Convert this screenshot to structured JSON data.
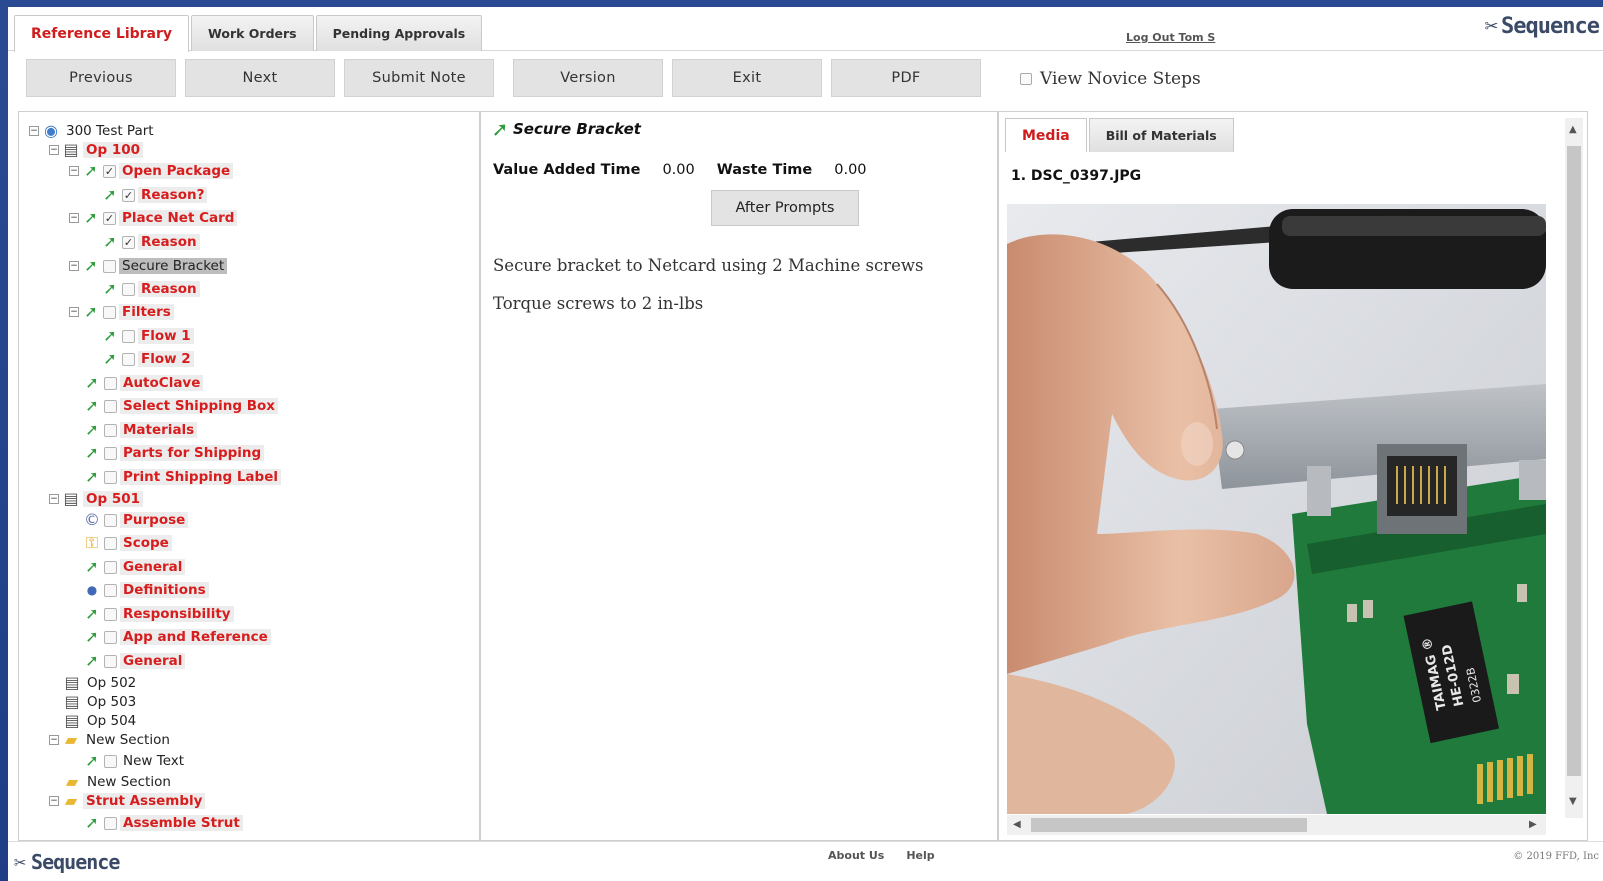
{
  "header": {
    "tabs": [
      {
        "label": "Reference Library",
        "active": true
      },
      {
        "label": "Work Orders",
        "active": false
      },
      {
        "label": "Pending Approvals",
        "active": false
      }
    ],
    "logout": "Log Out Tom S",
    "brand": "Sequence"
  },
  "toolbar": {
    "previous": "Previous",
    "next": "Next",
    "submit_note": "Submit Note",
    "version": "Version",
    "exit": "Exit",
    "pdf": "PDF",
    "novice_label": "View Novice Steps"
  },
  "tree": {
    "root": "300 Test Part",
    "op100": "Op 100",
    "open_package": "Open Package",
    "reason_q": "Reason?",
    "place_net_card": "Place Net Card",
    "reason1": "Reason",
    "secure_bracket": "Secure Bracket",
    "reason2": "Reason",
    "filters": "Filters",
    "flow1": "Flow 1",
    "flow2": "Flow 2",
    "autoclave": "AutoClave",
    "select_box": "Select Shipping Box",
    "materials": "Materials",
    "parts_shipping": "Parts for Shipping",
    "print_label": "Print Shipping Label",
    "op501": "Op 501",
    "purpose": "Purpose",
    "scope": "Scope",
    "general1": "General",
    "definitions": "Definitions",
    "responsibility": "Responsibility",
    "app_ref": "App and Reference",
    "general2": "General",
    "op502": "Op 502",
    "op503": "Op 503",
    "op504": "Op 504",
    "new_section1": "New Section",
    "new_text": "New Text",
    "new_section2": "New Section",
    "strut_assembly": "Strut Assembly",
    "assemble_strut": "Assemble Strut"
  },
  "step": {
    "title": "Secure Bracket",
    "value_added_label": "Value Added Time",
    "value_added": "0.00",
    "waste_label": "Waste Time",
    "waste": "0.00",
    "after_prompts": "After Prompts",
    "instruction1": "Secure bracket to Netcard using 2 Machine screws",
    "instruction2": "Torque screws to 2 in-lbs"
  },
  "media": {
    "tab_media": "Media",
    "tab_bom": "Bill of Materials",
    "file": "1. DSC_0397.JPG",
    "chip_text_1": "TAIMAG ®",
    "chip_text_2": "HE-012D",
    "chip_text_3": "0322B"
  },
  "footer": {
    "brand": "Sequence",
    "about": "About Us",
    "help": "Help",
    "copyright": "© 2019 FFD, Inc"
  }
}
